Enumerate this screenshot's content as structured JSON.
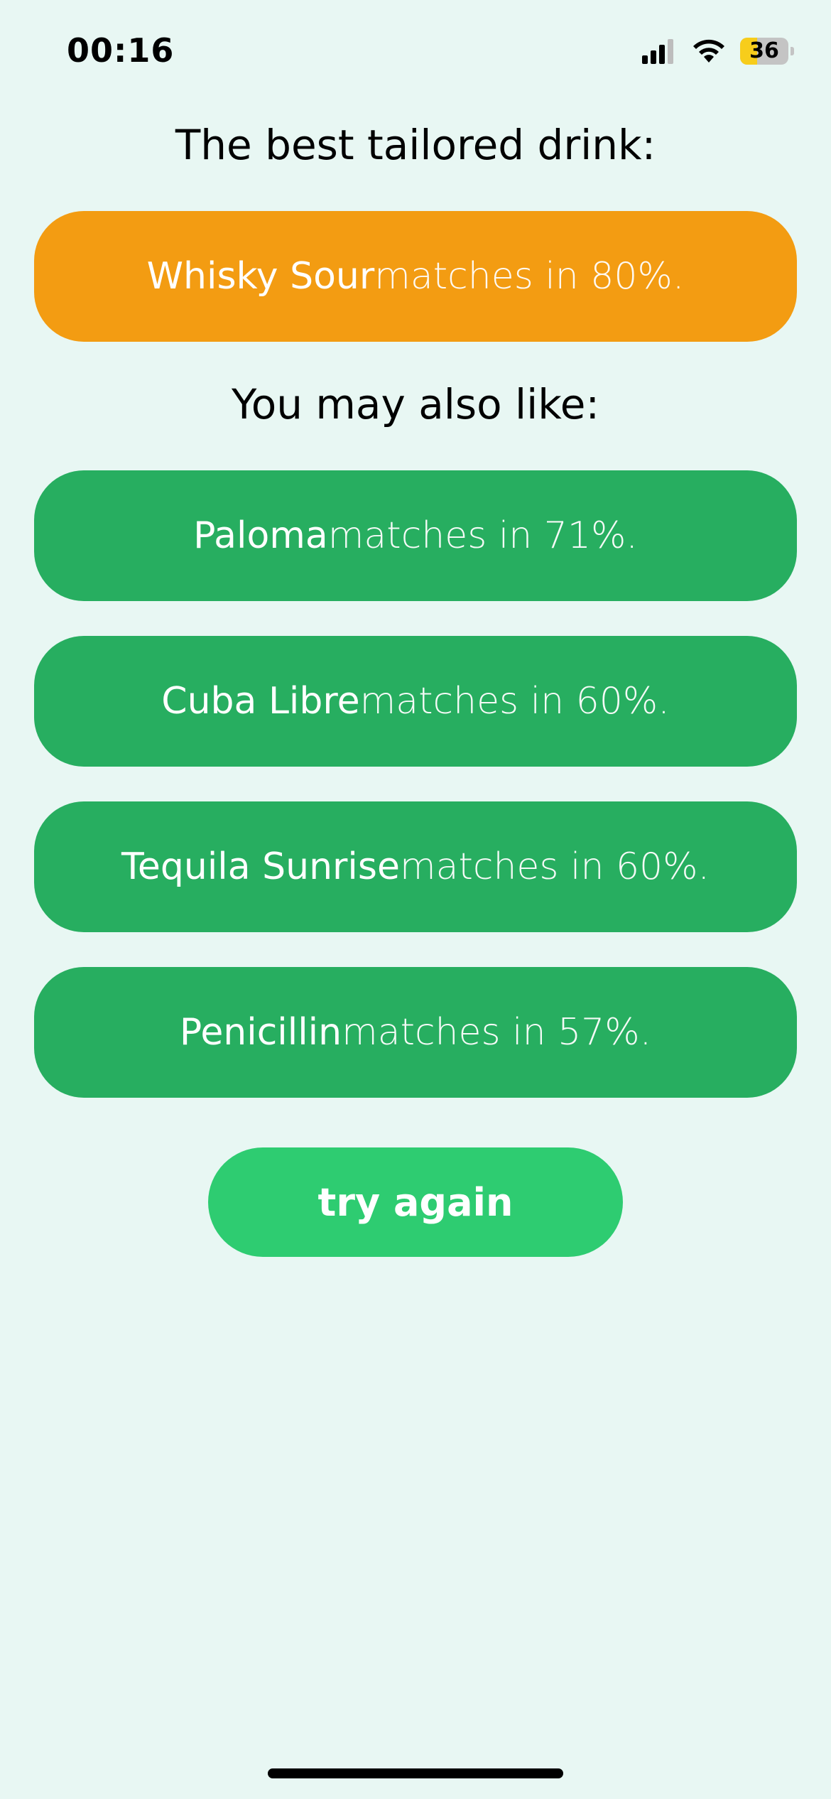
{
  "status_bar": {
    "time": "00:16",
    "battery_level": "36",
    "battery_fraction": 0.36
  },
  "best": {
    "heading": "The best tailored drink:",
    "drink": {
      "name": "Whisky Sour",
      "suffix": " matches in 80%."
    }
  },
  "also": {
    "heading": "You may also like:",
    "drinks": [
      {
        "name": "Paloma",
        "suffix": " matches in 71%."
      },
      {
        "name": "Cuba Libre",
        "suffix": " matches in 60%."
      },
      {
        "name": "Tequila Sunrise",
        "suffix": " matches in 60%."
      },
      {
        "name": "Penicillin",
        "suffix": " matches in 57%."
      }
    ]
  },
  "actions": {
    "try_again_label": "try again"
  },
  "colors": {
    "background": "#e8f7f3",
    "best_pill": "#f39c12",
    "suggestion_pill": "#27ae60",
    "try_again_button": "#2ecc71"
  },
  "icons": {
    "signal": "cellular-signal-icon",
    "wifi": "wifi-icon",
    "battery": "battery-icon"
  }
}
